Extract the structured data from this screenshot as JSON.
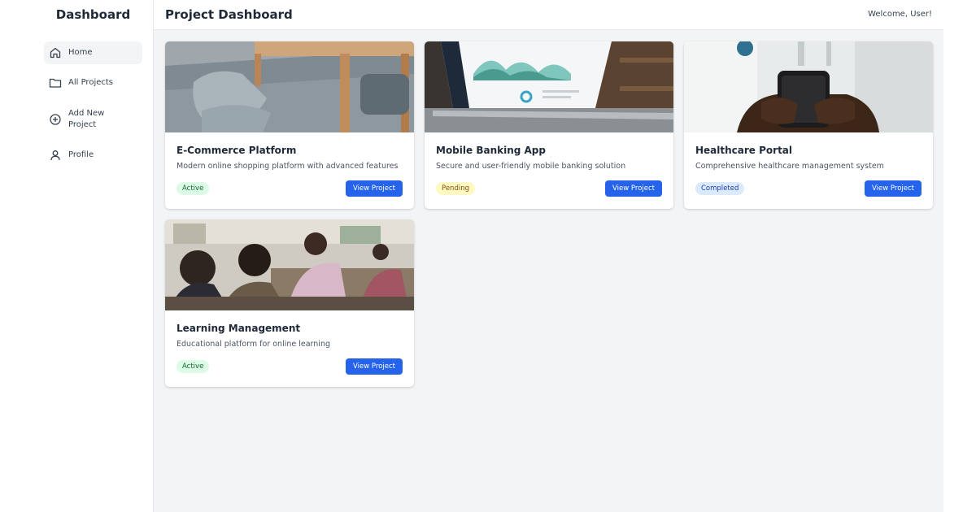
{
  "sidebar": {
    "title": "Dashboard",
    "items": [
      {
        "label": "Home",
        "icon": "home-icon",
        "active": true
      },
      {
        "label": "All Projects",
        "icon": "folder-icon",
        "active": false
      },
      {
        "label": "Add New Project",
        "icon": "plus-circle-icon",
        "active": false
      },
      {
        "label": "Profile",
        "icon": "user-icon",
        "active": false
      }
    ]
  },
  "header": {
    "title": "Project Dashboard",
    "welcome": "Welcome, User!"
  },
  "projects": [
    {
      "title": "E-Commerce Platform",
      "description": "Modern online shopping platform with advanced features",
      "status": "Active",
      "button": "View Project",
      "image": "desk-chair-photo"
    },
    {
      "title": "Mobile Banking App",
      "description": "Secure and user-friendly mobile banking solution",
      "status": "Pending",
      "button": "View Project",
      "image": "laptop-analytics-photo"
    },
    {
      "title": "Healthcare Portal",
      "description": "Comprehensive healthcare management system",
      "status": "Completed",
      "button": "View Project",
      "image": "doctor-phone-photo"
    },
    {
      "title": "Learning Management",
      "description": "Educational platform for online learning",
      "status": "Active",
      "button": "View Project",
      "image": "classroom-photo"
    }
  ],
  "colors": {
    "primary": "#2563eb",
    "main_bg": "#f3f4f6",
    "active_badge_bg": "#dcfce7",
    "pending_badge_bg": "#fef9c3",
    "completed_badge_bg": "#dbeafe"
  }
}
